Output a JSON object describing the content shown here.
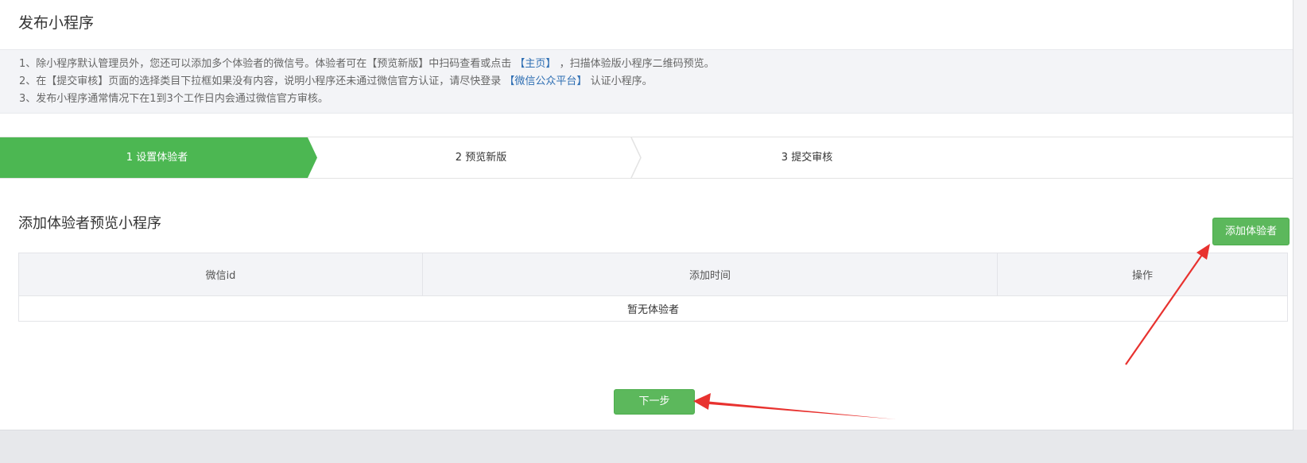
{
  "page_title": "发布小程序",
  "notice": {
    "line1_prefix": "1、除小程序默认管理员外，您还可以添加多个体验者的微信号。体验者可在【预览新版】中扫码查看或点击",
    "line1_link": "【主页】",
    "line1_suffix": "，扫描体验版小程序二维码预览。",
    "line2_prefix": "2、在【提交审核】页面的选择类目下拉框如果没有内容，说明小程序还未通过微信官方认证，请尽快登录",
    "line2_link": "【微信公众平台】",
    "line2_suffix": "认证小程序。",
    "line3": "3、发布小程序通常情况下在1到3个工作日内会通过微信官方审核。"
  },
  "steps": [
    {
      "label": "1 设置体验者",
      "active": true
    },
    {
      "label": "2 预览新版",
      "active": false
    },
    {
      "label": "3 提交审核",
      "active": false
    }
  ],
  "section_title": "添加体验者预览小程序",
  "add_button_label": "添加体验者",
  "table": {
    "columns": [
      "微信id",
      "添加时间",
      "操作"
    ],
    "empty_text": "暂无体验者"
  },
  "next_button_label": "下一步",
  "colors": {
    "accent_green": "#4cb752",
    "button_green": "#5cb85c",
    "link_blue": "#2f6fb3",
    "annotation_red": "#e8322f"
  }
}
